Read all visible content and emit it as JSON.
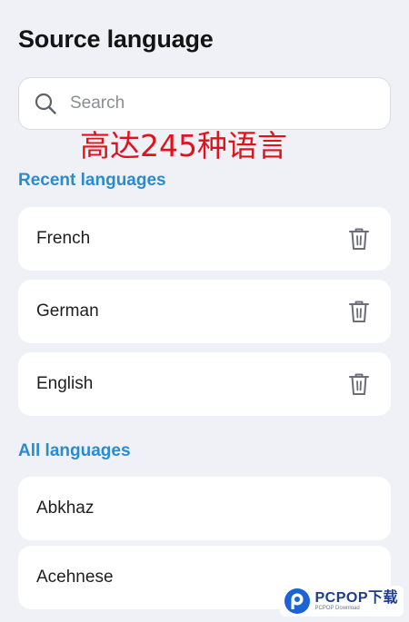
{
  "header": {
    "title": "Source language"
  },
  "search": {
    "placeholder": "Search"
  },
  "overlay": {
    "caption": "高达245种语言",
    "color": "#e0121b"
  },
  "recent": {
    "heading": "Recent languages",
    "items": [
      {
        "label": "French",
        "icon": "trash-icon"
      },
      {
        "label": "German",
        "icon": "trash-icon"
      },
      {
        "label": "English",
        "icon": "trash-icon"
      }
    ]
  },
  "all": {
    "heading": "All languages",
    "items": [
      {
        "label": "Abkhaz"
      },
      {
        "label": "Acehnese"
      }
    ]
  },
  "watermark": {
    "text": "PCPOP下载",
    "subtext": "PCPOP Download"
  },
  "colors": {
    "accent": "#2a8bd1",
    "background": "#eff1f6",
    "card": "#ffffff"
  }
}
